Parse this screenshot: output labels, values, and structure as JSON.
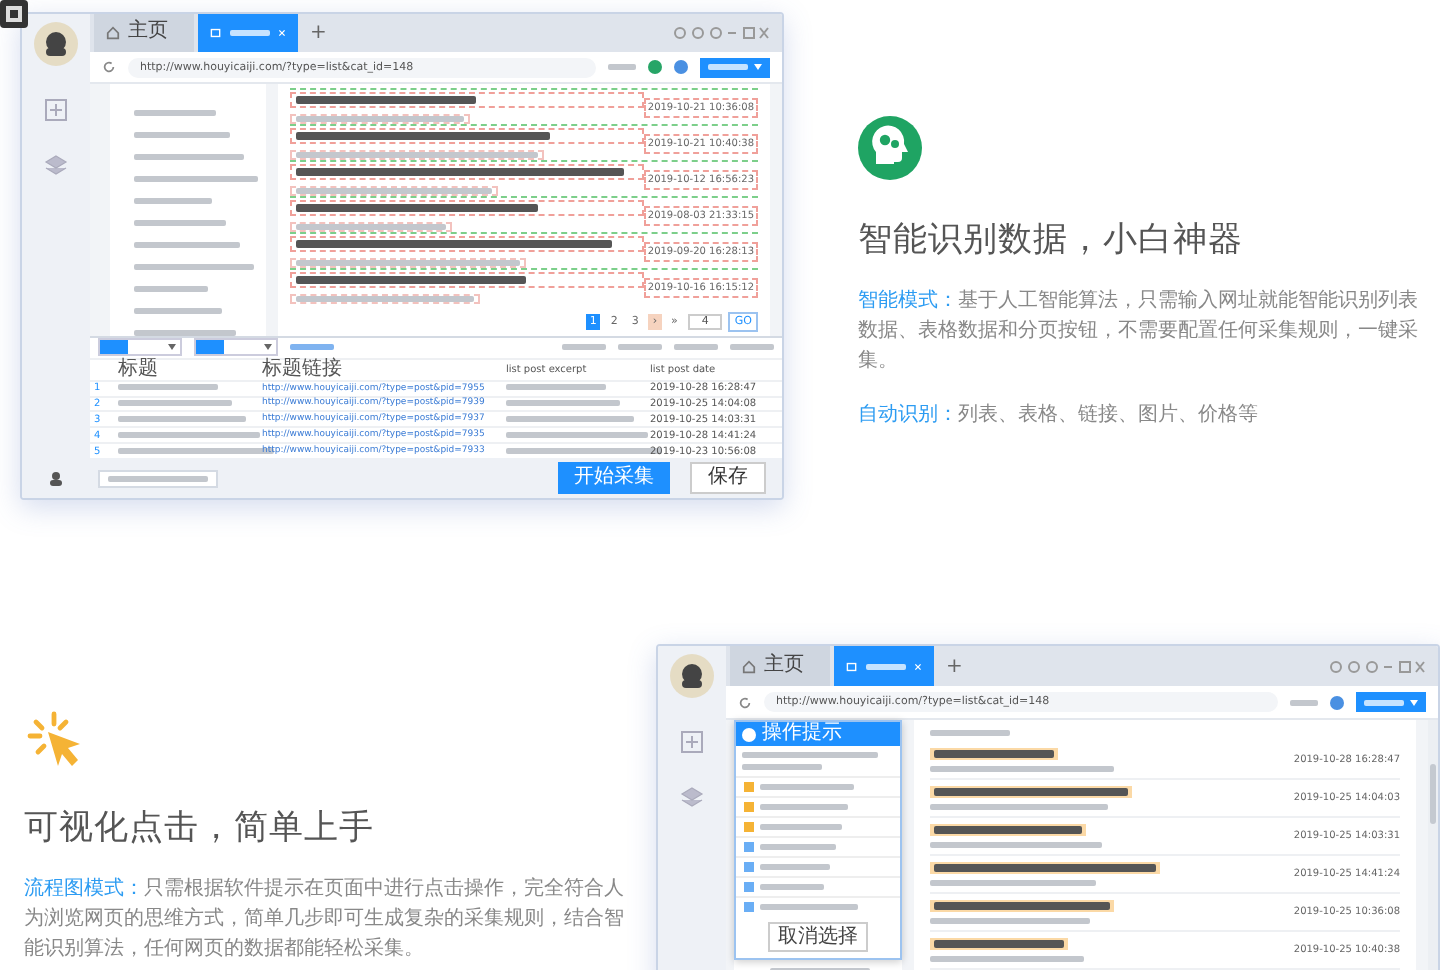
{
  "app_window_top": {
    "tabs": [
      {
        "label": "主页",
        "selected": false
      },
      {
        "selected": true
      }
    ],
    "new_tab": "+",
    "url": "http://www.houyicaiji.com/?type=list&cat_id=148",
    "articles": [
      {
        "date": "2019-10-21 10:36:08"
      },
      {
        "date": "2019-10-21 10:40:38"
      },
      {
        "date": "2019-10-12 16:56:23"
      },
      {
        "date": "2019-08-03 21:33:15"
      },
      {
        "date": "2019-09-20 16:28:13"
      },
      {
        "date": "2019-10-16 16:15:12"
      }
    ],
    "pagination": {
      "pages": [
        {
          "label": "1",
          "selected": true
        },
        {
          "label": "2",
          "selected": false
        },
        {
          "label": "3",
          "selected": false
        }
      ],
      "next": "›",
      "last": "»",
      "page_input": "4",
      "go": "GO"
    },
    "table": {
      "columns": [
        "标题",
        "标题链接",
        "list post excerpt",
        "list post date"
      ],
      "rows": [
        {
          "index": "1",
          "link": "http://www.houyicaiji.com/?type=post&pid=7955",
          "date": "2019-10-28 16:28:47"
        },
        {
          "index": "2",
          "link": "http://www.houyicaiji.com/?type=post&pid=7939",
          "date": "2019-10-25 14:04:08"
        },
        {
          "index": "3",
          "link": "http://www.houyicaiji.com/?type=post&pid=7937",
          "date": "2019-10-25 14:03:31"
        },
        {
          "index": "4",
          "link": "http://www.houyicaiji.com/?type=post&pid=7935",
          "date": "2019-10-28 14:41:24"
        },
        {
          "index": "5",
          "link": "http://www.houyicaiji.com/?type=post&pid=7933",
          "date": "2019-10-23 10:56:08"
        }
      ]
    },
    "start_button": "开始采集",
    "save_button": "保存"
  },
  "feature_1": {
    "title": "智能识别数据，小白神器",
    "paragraphs": [
      {
        "label": "智能模式：",
        "text": "基于人工智能算法，只需输入网址就能智能识别列表数据、表格数据和分页按钮，不需要配置任何采集规则，一键采集。"
      },
      {
        "label": "自动识别：",
        "text": "列表、表格、链接、图片、价格等"
      }
    ]
  },
  "feature_2": {
    "title": "可视化点击，简单上手",
    "paragraphs": [
      {
        "label": "流程图模式：",
        "text": "只需根据软件提示在页面中进行点击操作，完全符合人为浏览网页的思维方式，简单几步即可生成复杂的采集规则，结合智能识别算法，任何网页的数据都能轻松采集。"
      }
    ]
  },
  "app_window_bottom": {
    "tabs": [
      {
        "label": "主页",
        "selected": false
      },
      {
        "selected": true
      }
    ],
    "new_tab": "+",
    "url": "http://www.houyicaiji.com/?type=list&cat_id=148",
    "popup": {
      "title": "操作提示",
      "button": "取消选择"
    },
    "articles": [
      {
        "date": "2019-10-28 16:28:47"
      },
      {
        "date": "2019-10-25 14:04:03"
      },
      {
        "date": "2019-10-25 14:03:31"
      },
      {
        "date": "2019-10-25 14:41:24"
      },
      {
        "date": "2019-10-25 10:36:08"
      },
      {
        "date": "2019-10-25 10:40:38"
      }
    ]
  }
}
